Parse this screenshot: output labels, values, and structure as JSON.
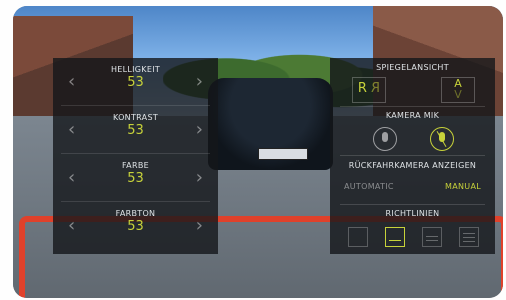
{
  "left_panel": {
    "adjustments": [
      {
        "label": "HELLIGKEIT",
        "value": "53"
      },
      {
        "label": "KONTRAST",
        "value": "53"
      },
      {
        "label": "FARBE",
        "value": "53"
      },
      {
        "label": "FARBTON",
        "value": "53"
      }
    ]
  },
  "right_panel": {
    "mirror": {
      "title": "SPIEGELANSICHT",
      "letter": "R",
      "letter_mirrored": "R",
      "arrow_up": "A",
      "arrow_down": "V"
    },
    "mic": {
      "title": "KAMERA MIK",
      "state": "muted-selected"
    },
    "display": {
      "title": "RÜCKFAHRKAMERA ANZEIGEN",
      "option_auto": "AUTOMATIC",
      "option_manual": "MANUAL",
      "selected": "MANUAL"
    },
    "guidelines": {
      "title": "RICHTLINIEN",
      "selected_index": 1
    }
  },
  "colors": {
    "accent": "#c7d23a",
    "guide_red": "#e0412b"
  }
}
